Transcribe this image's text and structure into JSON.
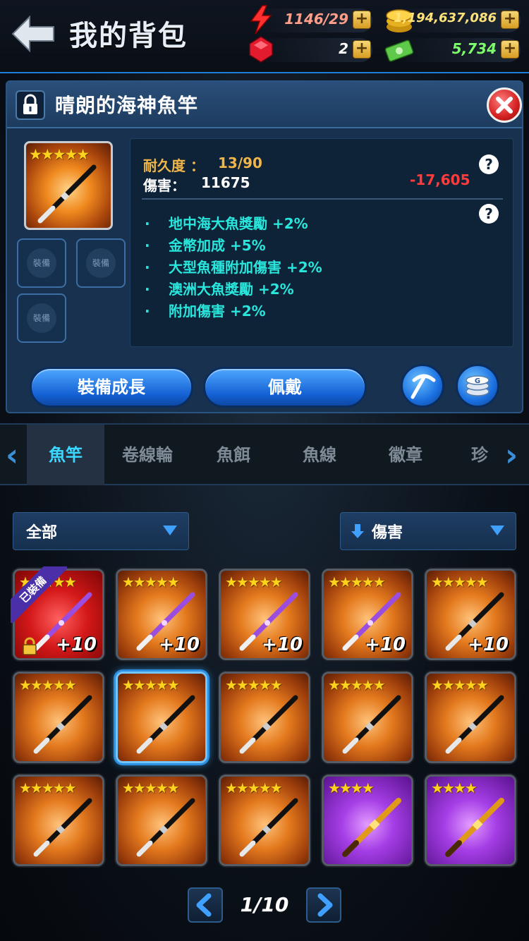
{
  "header": {
    "title": "我的背包",
    "energy": "1146/29",
    "gold": "1,194,637,086",
    "gems": "2",
    "cash": "5,734"
  },
  "item": {
    "name": "晴朗的海神魚竿",
    "stars": 5,
    "durability_label": "耐久度 ：",
    "durability_value": "13/90",
    "damage_label": "傷害：",
    "damage_value": "11675",
    "damage_diff": "-17,605",
    "sub_slot_label": "裝備",
    "bonuses": [
      "地中海大魚獎勵 +2%",
      "金幣加成 +5%",
      "大型魚種附加傷害 +2%",
      "澳洲大魚獎勵 +2%",
      "附加傷害 +2%"
    ],
    "btn_upgrade": "裝備成長",
    "btn_equip": "佩戴"
  },
  "tabs": [
    "魚竿",
    "卷線輪",
    "魚餌",
    "魚線",
    "徽章",
    "珍珏"
  ],
  "filters": {
    "category": "全部",
    "sort": "傷害"
  },
  "grid": {
    "equipped_label": "已裝備",
    "plus_label": "+10",
    "items": [
      {
        "bg": "red",
        "stars": 5,
        "plus": true,
        "equipped": true,
        "rod": "purple"
      },
      {
        "bg": "orange",
        "stars": 5,
        "plus": true,
        "rod": "purple"
      },
      {
        "bg": "orange",
        "stars": 5,
        "plus": true,
        "rod": "purple"
      },
      {
        "bg": "orange",
        "stars": 5,
        "plus": true,
        "rod": "purple"
      },
      {
        "bg": "orange",
        "stars": 5,
        "plus": true,
        "rod": "black"
      },
      {
        "bg": "orange",
        "stars": 5,
        "rod": "black"
      },
      {
        "bg": "orange",
        "stars": 5,
        "rod": "black",
        "selected": true
      },
      {
        "bg": "orange",
        "stars": 5,
        "rod": "black"
      },
      {
        "bg": "orange",
        "stars": 5,
        "rod": "black"
      },
      {
        "bg": "orange",
        "stars": 5,
        "rod": "black"
      },
      {
        "bg": "orange",
        "stars": 5,
        "rod": "black"
      },
      {
        "bg": "orange",
        "stars": 5,
        "rod": "black"
      },
      {
        "bg": "orange",
        "stars": 5,
        "rod": "black"
      },
      {
        "bg": "purple",
        "stars": 4,
        "rod": "gold"
      },
      {
        "bg": "purple",
        "stars": 4,
        "rod": "gold"
      }
    ]
  },
  "pager": {
    "text": "1/10"
  },
  "colors": {
    "accent_blue": "#1f7fd6",
    "bonus_cyan": "#29e6dc",
    "damage_red": "#ff3b3b",
    "label_gold": "#f0b64a"
  }
}
